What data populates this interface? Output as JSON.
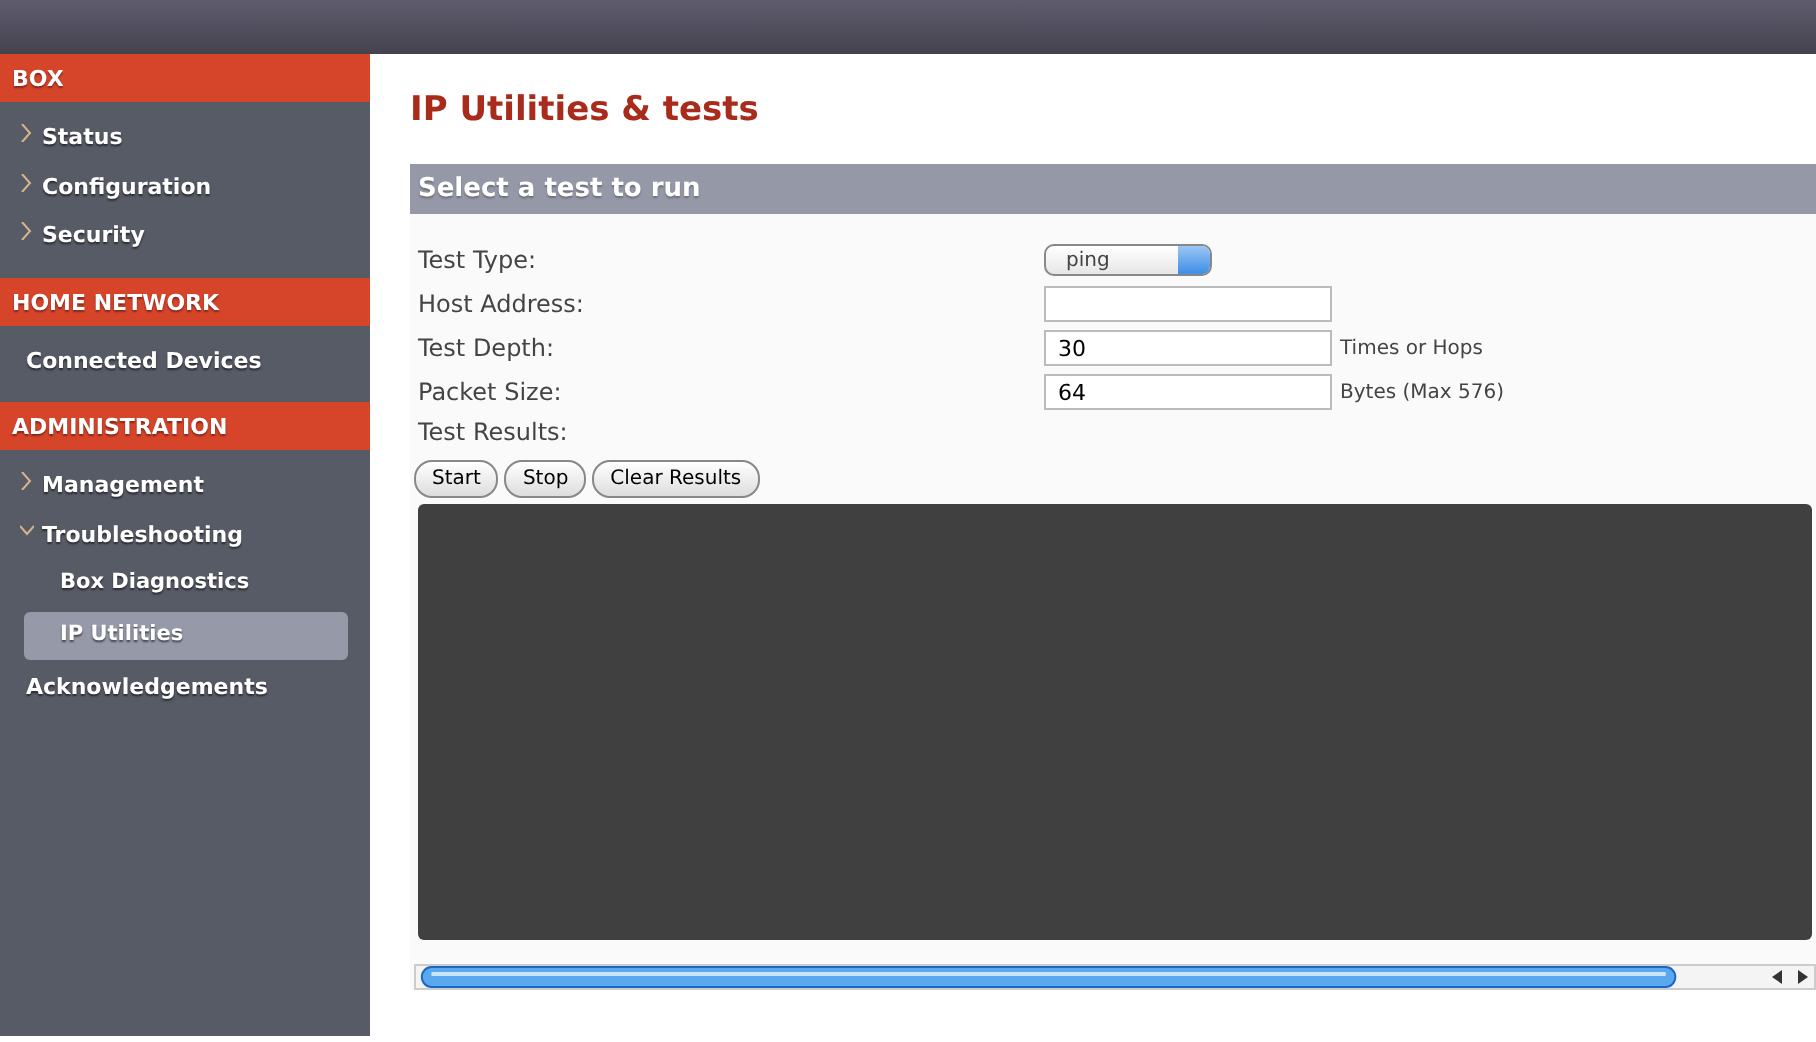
{
  "sidebar": {
    "sections": [
      {
        "title": "BOX",
        "items": [
          {
            "label": "Status",
            "kind": "collapsible",
            "expanded": false,
            "selected": false
          },
          {
            "label": "Configuration",
            "kind": "collapsible",
            "expanded": false,
            "selected": false
          },
          {
            "label": "Security",
            "kind": "collapsible",
            "expanded": false,
            "selected": false
          }
        ]
      },
      {
        "title": "HOME NETWORK",
        "items": [
          {
            "label": "Connected Devices",
            "kind": "link",
            "selected": false
          }
        ]
      },
      {
        "title": "ADMINISTRATION",
        "items": [
          {
            "label": "Management",
            "kind": "collapsible",
            "expanded": false,
            "selected": false
          },
          {
            "label": "Troubleshooting",
            "kind": "collapsible",
            "expanded": true,
            "selected": false,
            "children": [
              {
                "label": "Box Diagnostics",
                "selected": false
              },
              {
                "label": "IP Utilities",
                "selected": true
              }
            ]
          },
          {
            "label": "Acknowledgements",
            "kind": "link",
            "selected": false
          }
        ]
      }
    ]
  },
  "page_title": "IP Utilities & tests",
  "panel": {
    "title": "Select a test to run",
    "fields": [
      {
        "label": "Test Type:",
        "kind": "select",
        "value": "ping"
      },
      {
        "label": "Host Address:",
        "kind": "input"
      },
      {
        "label": "Test Depth:",
        "kind": "input",
        "value": "30",
        "suffix": "Times or Hops"
      },
      {
        "label": "Packet Size:",
        "kind": "input",
        "value": "64",
        "suffix": "Bytes (Max 576)"
      }
    ],
    "results_label": "Test Results:",
    "buttons": [
      "Start",
      "Stop",
      "Clear Results"
    ]
  }
}
